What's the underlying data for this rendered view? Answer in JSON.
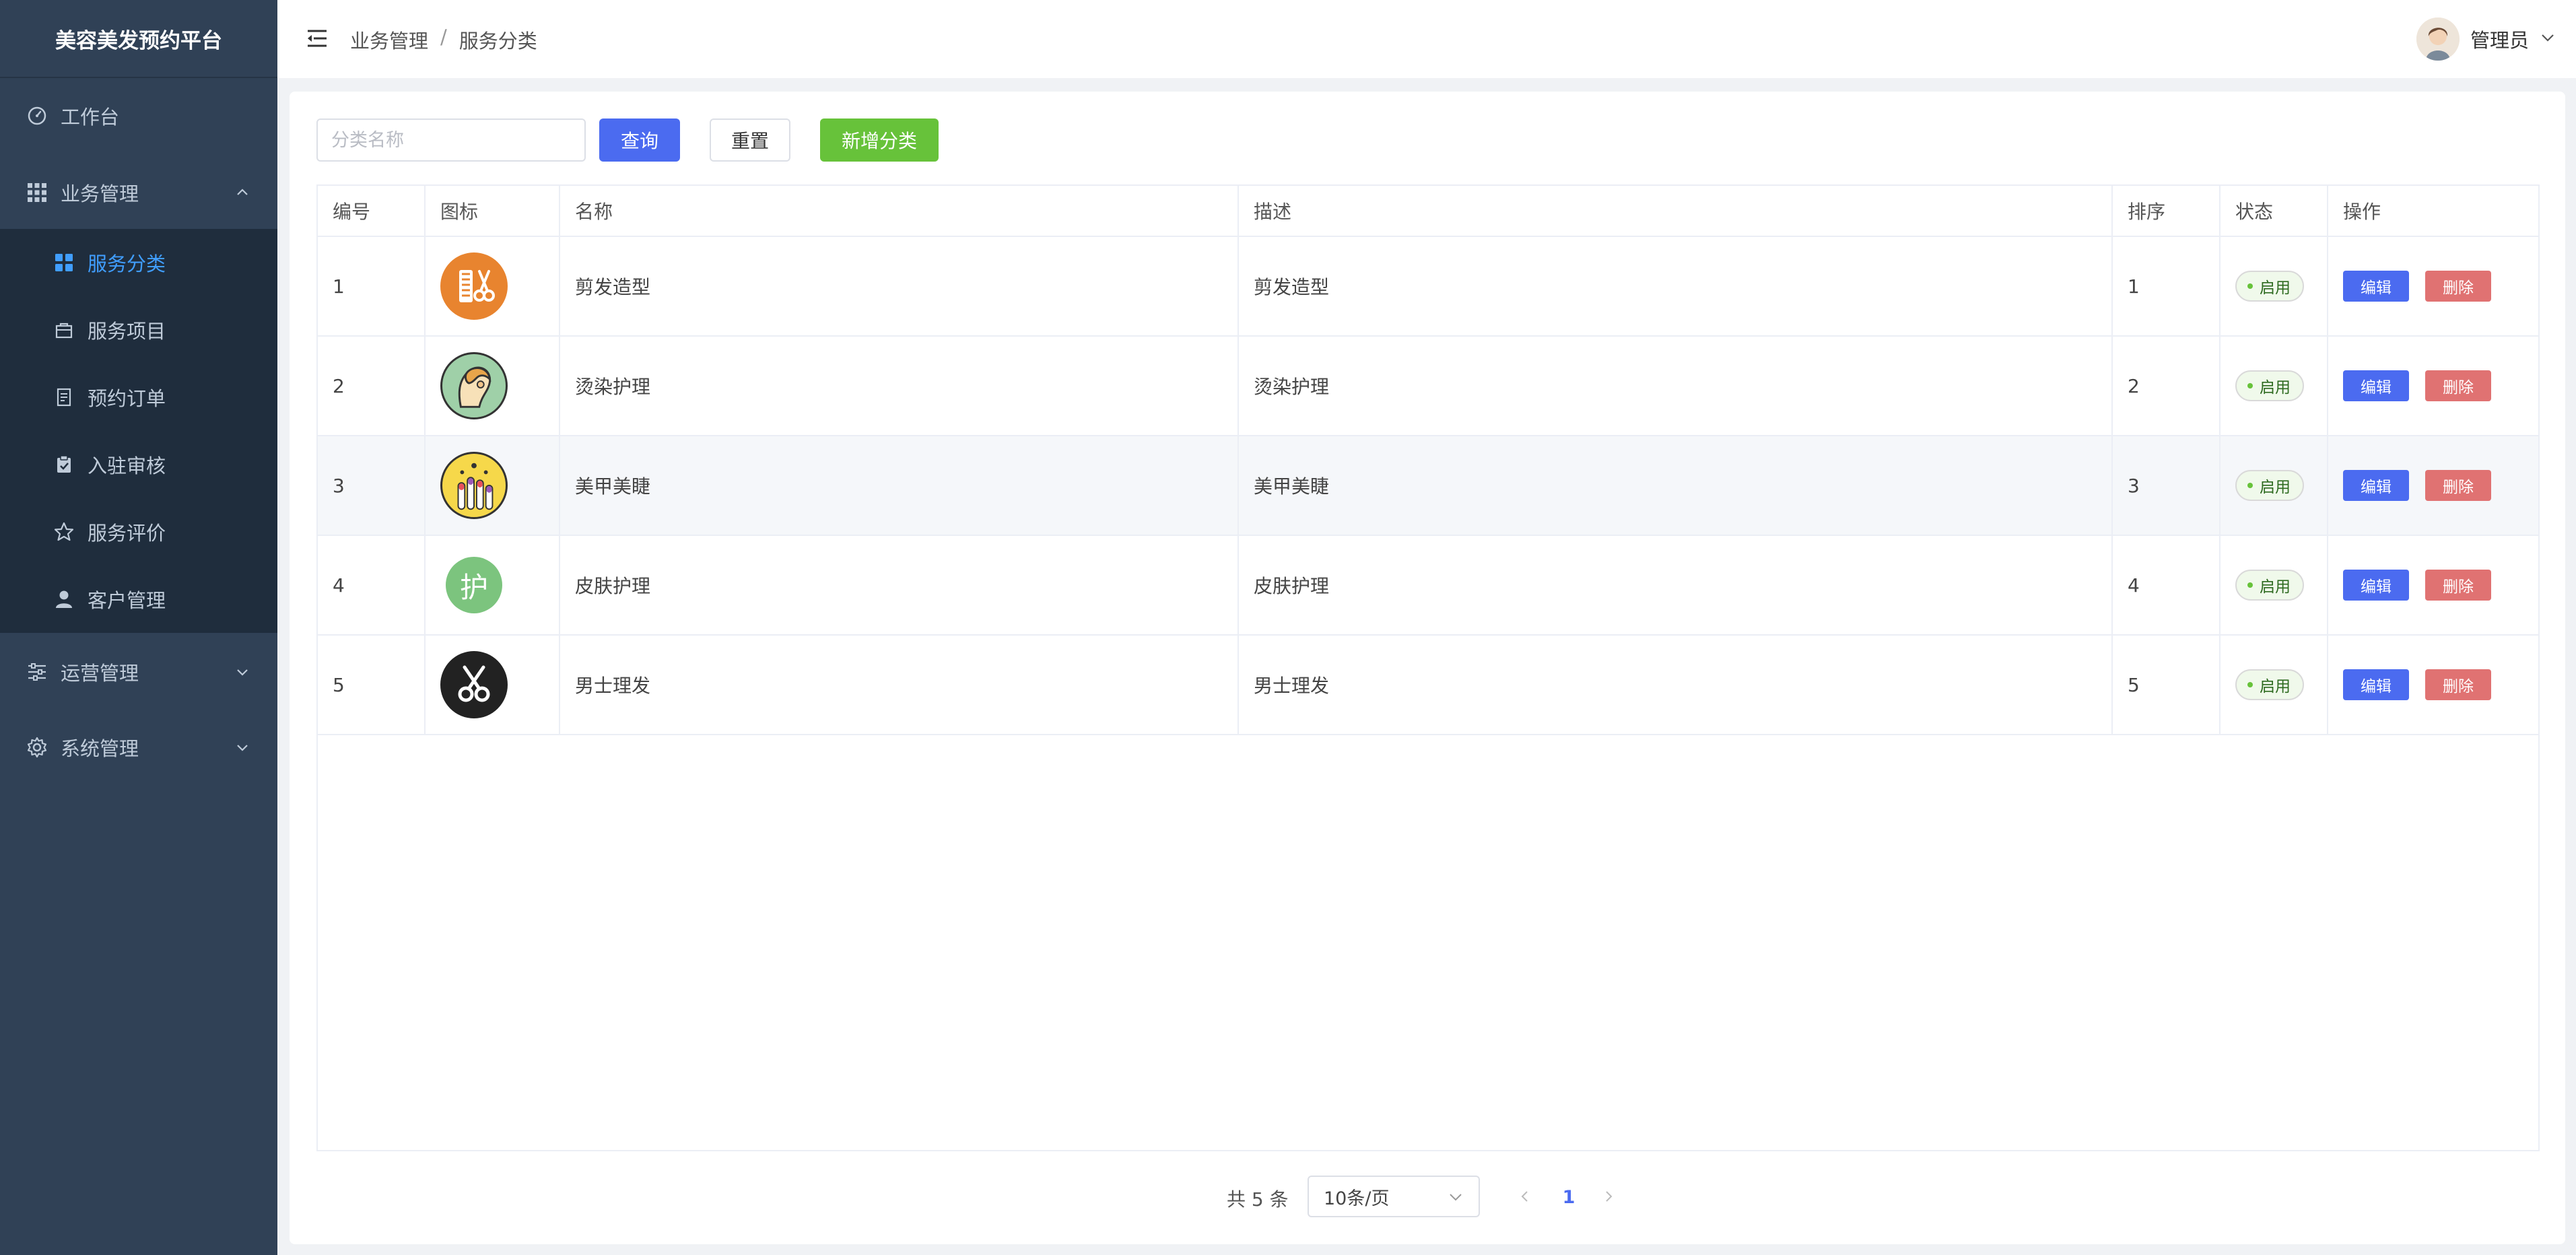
{
  "sidebar": {
    "brand": "美容美发预约平台",
    "workbench": "工作台",
    "business": "业务管理",
    "sub_items": [
      {
        "label": "服务分类",
        "icon": "grid-icon"
      },
      {
        "label": "服务项目",
        "icon": "bag-icon"
      },
      {
        "label": "预约订单",
        "icon": "document-icon"
      },
      {
        "label": "入驻审核",
        "icon": "clipboard-check-icon"
      },
      {
        "label": "服务评价",
        "icon": "star-icon"
      },
      {
        "label": "客户管理",
        "icon": "user-icon"
      }
    ],
    "operations": "运营管理",
    "system": "系统管理",
    "active_color": "#409eff"
  },
  "header": {
    "breadcrumb": [
      "业务管理",
      "服务分类"
    ],
    "breadcrumb_sep": "/",
    "user_name": "管理员"
  },
  "toolbar": {
    "search_placeholder": "分类名称",
    "search_value": "",
    "query_label": "查询",
    "reset_label": "重置",
    "add_label": "新增分类"
  },
  "table": {
    "columns": [
      "编号",
      "图标",
      "名称",
      "描述",
      "排序",
      "状态",
      "操作"
    ],
    "rows": [
      {
        "id": "1",
        "icon": "comb-scissors-icon",
        "name": "剪发造型",
        "desc": "剪发造型",
        "sort": "1",
        "status": "启用"
      },
      {
        "id": "2",
        "icon": "woman-profile-icon",
        "name": "烫染护理",
        "desc": "烫染护理",
        "sort": "2",
        "status": "启用"
      },
      {
        "id": "3",
        "icon": "nail-polish-icon",
        "name": "美甲美睫",
        "desc": "美甲美睫",
        "sort": "3",
        "status": "启用"
      },
      {
        "id": "4",
        "icon": "care-badge-icon",
        "icon_text": "护",
        "name": "皮肤护理",
        "desc": "皮肤护理",
        "sort": "4",
        "status": "启用"
      },
      {
        "id": "5",
        "icon": "scissors-icon",
        "name": "男士理发",
        "desc": "男士理发",
        "sort": "5",
        "status": "启用"
      }
    ],
    "edit_label": "编辑",
    "delete_label": "删除"
  },
  "pagination": {
    "total": "共 5 条",
    "page_size": "10条/页",
    "current_page": "1"
  },
  "colors": {
    "primary": "#4b6bf0",
    "success": "#67c23a",
    "danger": "#e07272",
    "sidebar_bg": "#304156"
  }
}
